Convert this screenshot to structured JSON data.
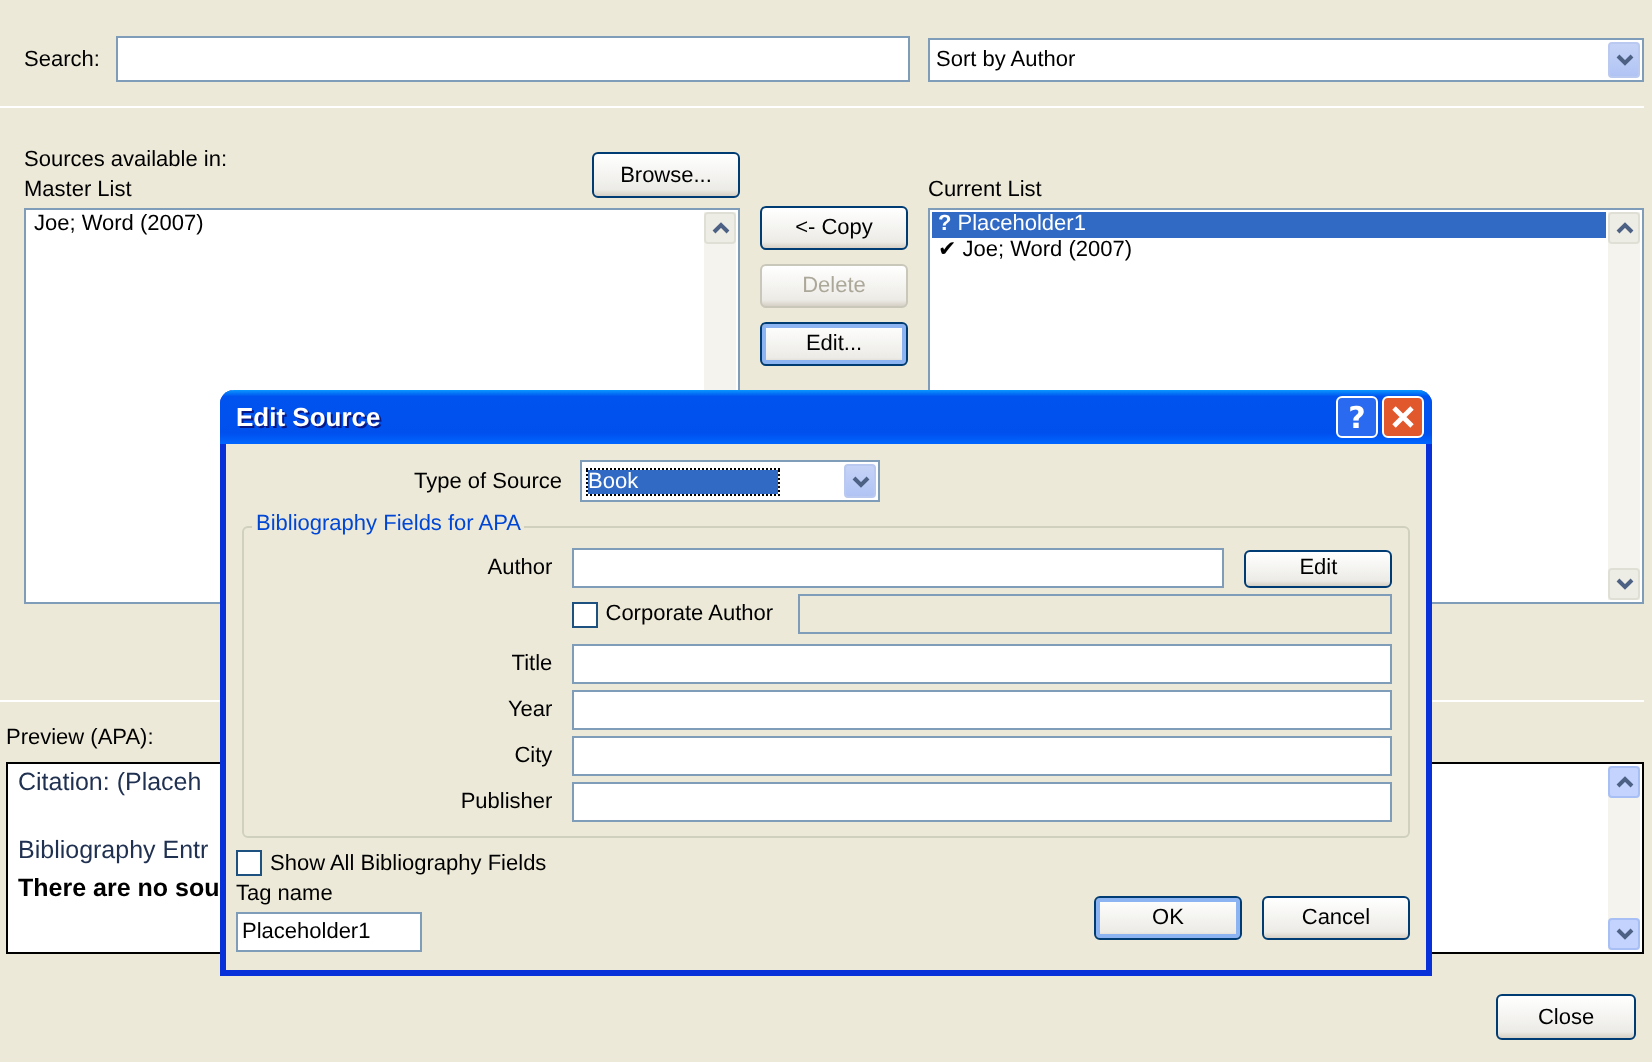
{
  "search": {
    "label": "Search:"
  },
  "sort": {
    "value": "Sort by Author"
  },
  "sources_label": "Sources available in:",
  "master_label": "Master List",
  "browse_button": "Browse...",
  "master_list": {
    "items": [
      {
        "text": "Joe; Word (2007)",
        "selected": false
      }
    ]
  },
  "actions": [
    {
      "label": "<- Copy",
      "disabled": false,
      "focused": false
    },
    {
      "label": "Delete",
      "disabled": true,
      "focused": false
    },
    {
      "label": "Edit...",
      "disabled": false,
      "focused": true
    }
  ],
  "current_list": {
    "label": "Current List",
    "items": [
      {
        "mark": "?",
        "text": "Placeholder1",
        "selected": true
      },
      {
        "mark": "✔",
        "text": "Joe; Word (2007)",
        "selected": false
      }
    ]
  },
  "preview": {
    "label": "Preview (APA):",
    "lines": [
      {
        "kind": "citation",
        "text": "Citation:  (Placeh"
      },
      {
        "kind": "heading",
        "text": "Bibliography Entr"
      },
      {
        "kind": "bold",
        "text": "There are no sou"
      }
    ]
  },
  "close_button": "Close",
  "dialog": {
    "title": "Edit Source",
    "help": "?",
    "type_label": "Type of Source",
    "type_value": "Book",
    "group_title": "Bibliography Fields for APA",
    "fields": [
      {
        "kind": "author",
        "label": "Author",
        "button": "Edit",
        "corporate": {
          "label": "Corporate Author",
          "checked": false
        }
      },
      {
        "kind": "text",
        "label": "Title"
      },
      {
        "kind": "text",
        "label": "Year"
      },
      {
        "kind": "text",
        "label": "City"
      },
      {
        "kind": "text",
        "label": "Publisher"
      }
    ],
    "show_all": {
      "label": "Show All Bibliography Fields",
      "checked": false
    },
    "tag": {
      "label": "Tag name",
      "value": "Placeholder1"
    },
    "buttons": [
      {
        "label": "OK",
        "focused": true
      },
      {
        "label": "Cancel",
        "focused": false
      }
    ]
  }
}
